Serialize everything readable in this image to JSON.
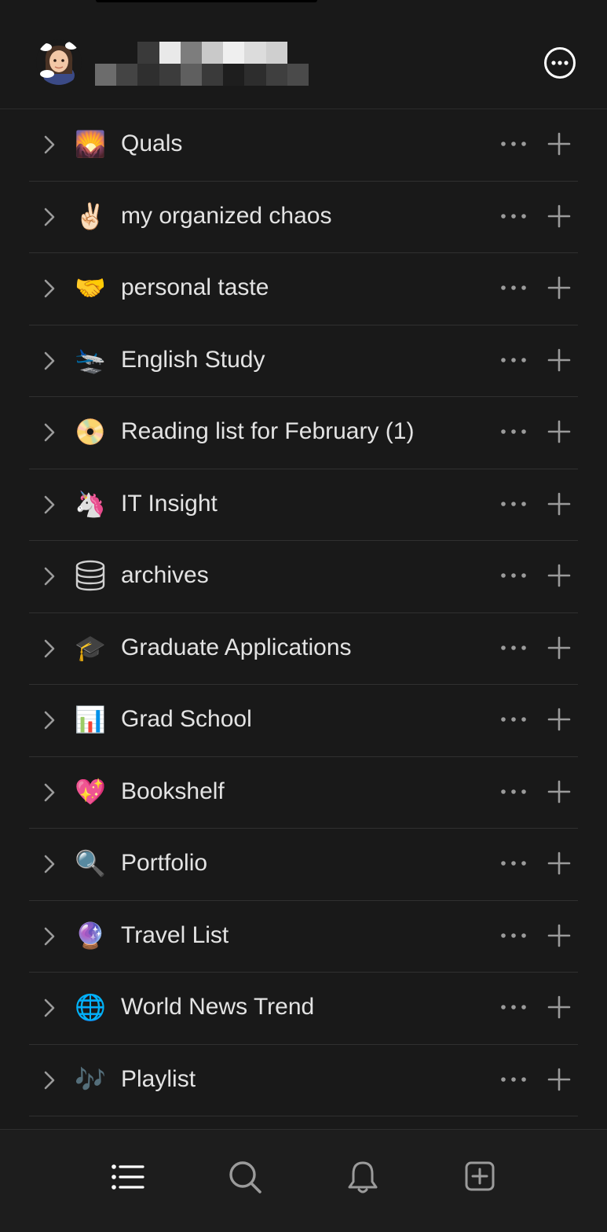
{
  "header": {
    "avatar_icon": "memoji-avatar",
    "workspace_name_redacted": true,
    "more_icon": "more-circle-icon"
  },
  "pages": [
    {
      "label": "Quals",
      "emoji": "🌄"
    },
    {
      "label": "my organized chaos",
      "emoji": "✌🏻"
    },
    {
      "label": "personal taste",
      "emoji": "🤝"
    },
    {
      "label": "English Study",
      "emoji": "🛬"
    },
    {
      "label": "Reading list for February (1)",
      "emoji": "📀"
    },
    {
      "label": "IT Insight",
      "emoji": "🦄"
    },
    {
      "label": "archives",
      "emoji": "🛢"
    },
    {
      "label": "Graduate Applications",
      "emoji": "🎓"
    },
    {
      "label": "Grad School",
      "emoji": "📊"
    },
    {
      "label": "Bookshelf",
      "emoji": "💖"
    },
    {
      "label": "Portfolio",
      "emoji": "🔍"
    },
    {
      "label": "Travel List",
      "emoji": "🔮"
    },
    {
      "label": "World News Trend",
      "emoji": "🌐"
    },
    {
      "label": "Playlist",
      "emoji": "🎶"
    }
  ],
  "row_actions": {
    "expand_icon": "chevron-right-icon",
    "more_icon": "ellipsis-icon",
    "add_icon": "plus-icon"
  },
  "tab_bar": [
    {
      "name": "pages",
      "icon": "list-icon"
    },
    {
      "name": "search",
      "icon": "search-icon"
    },
    {
      "name": "notifications",
      "icon": "bell-icon"
    },
    {
      "name": "new-page",
      "icon": "new-page-icon"
    }
  ],
  "colors": {
    "background": "#191919",
    "divider": "#303030",
    "text": "#e3e3e3",
    "icon": "#9b9b9b"
  }
}
